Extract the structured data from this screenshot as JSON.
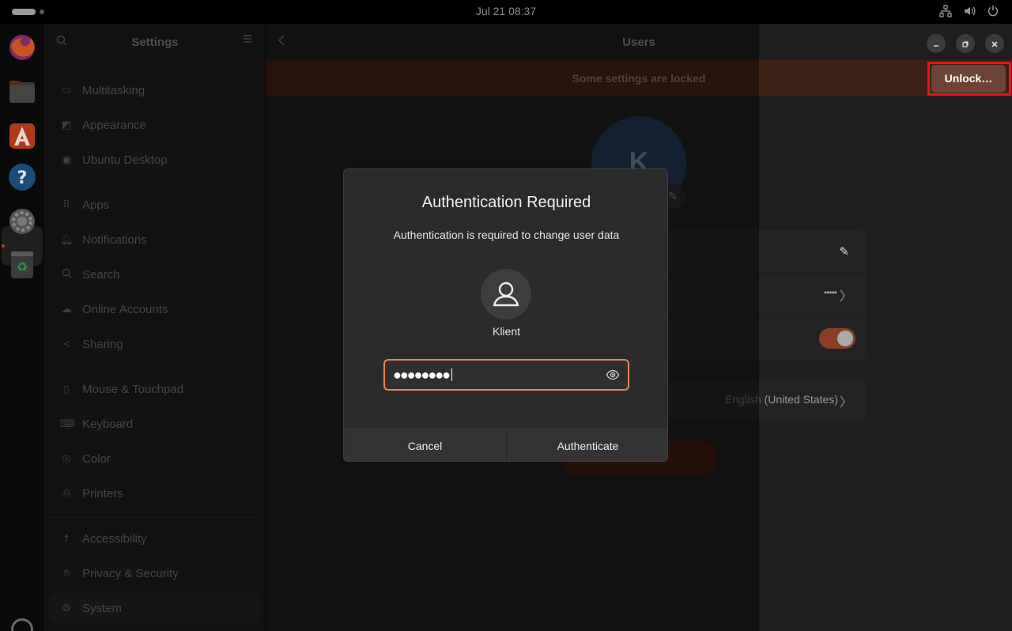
{
  "topbar": {
    "clock": "Jul 21  08:37",
    "icons": [
      "network-icon",
      "volume-icon",
      "power-icon"
    ]
  },
  "dock": {
    "apps": [
      "firefox-icon",
      "files-icon",
      "app-center-icon",
      "help-icon",
      "settings-icon",
      "trash-icon"
    ],
    "launcher": "ubuntu-logo-icon"
  },
  "sidebar": {
    "title": "Settings",
    "items": [
      {
        "label": "Multitasking",
        "icon": "multitasking-icon"
      },
      {
        "label": "Appearance",
        "icon": "appearance-icon"
      },
      {
        "label": "Ubuntu Desktop",
        "icon": "ubuntu-desktop-icon"
      },
      {
        "label": "Apps",
        "icon": "apps-icon"
      },
      {
        "label": "Notifications",
        "icon": "bell-icon"
      },
      {
        "label": "Search",
        "icon": "search-icon"
      },
      {
        "label": "Online Accounts",
        "icon": "cloud-icon"
      },
      {
        "label": "Sharing",
        "icon": "share-icon"
      },
      {
        "label": "Mouse & Touchpad",
        "icon": "mouse-icon"
      },
      {
        "label": "Keyboard",
        "icon": "keyboard-icon"
      },
      {
        "label": "Color",
        "icon": "color-icon"
      },
      {
        "label": "Printers",
        "icon": "printer-icon"
      },
      {
        "label": "Accessibility",
        "icon": "accessibility-icon"
      },
      {
        "label": "Privacy & Security",
        "icon": "hand-icon"
      },
      {
        "label": "System",
        "icon": "gear-icon"
      }
    ],
    "selected": "System"
  },
  "content": {
    "title": "Users",
    "infobar": "Some settings are locked",
    "unlock_label": "Unlock…",
    "avatar_initial": "K",
    "password_dots": "•••••",
    "language_prefix": "English ",
    "language_region": "(United States)"
  },
  "dialog": {
    "title": "Authentication Required",
    "subtitle": "Authentication is required to change user data",
    "username": "Klient",
    "password_masked": "●●●●●●●●",
    "cancel_label": "Cancel",
    "authenticate_label": "Authenticate"
  },
  "colors": {
    "accent": "#e9835d",
    "highlight": "#e3141e",
    "infobar_bg": "#3f2014"
  }
}
